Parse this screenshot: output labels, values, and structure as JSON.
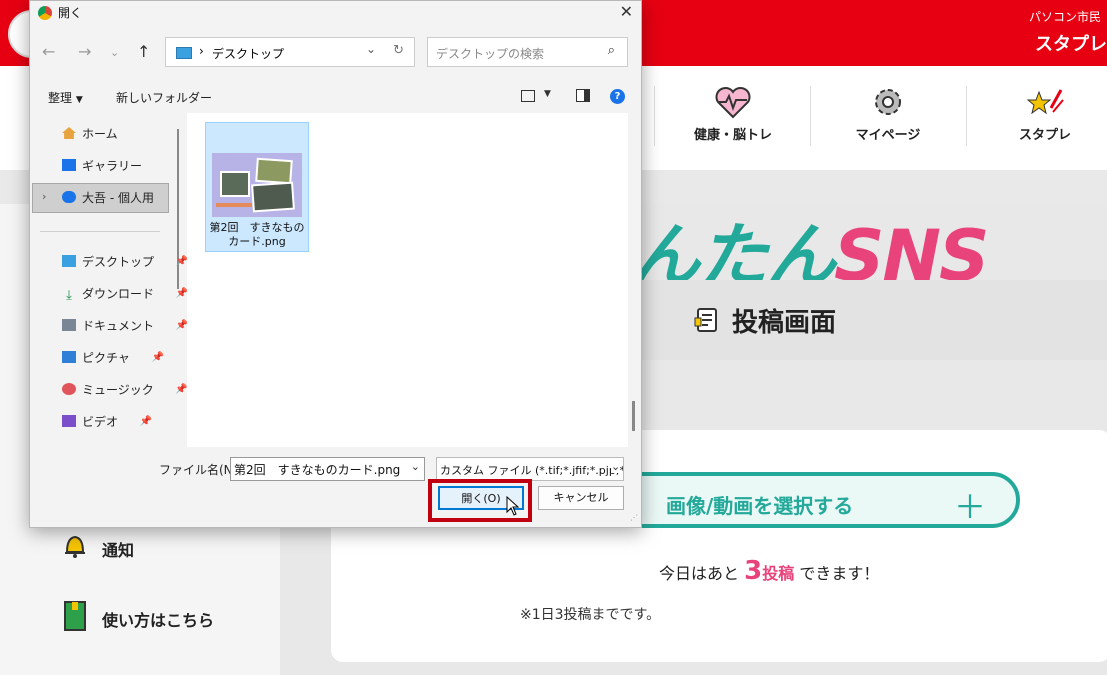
{
  "site": {
    "name": "パソコン市民",
    "brand": "スタプレ",
    "nav": [
      {
        "label": "健康・脳トレ",
        "icon": "heart-pulse-icon"
      },
      {
        "label": "マイページ",
        "icon": "gear-icon"
      },
      {
        "label": "スタプレ",
        "icon": "star-icon"
      }
    ],
    "sns_title_a": "んたん",
    "sns_title_b": "SNS",
    "post_title": "投稿画面",
    "select_media_label": "画像/動画を選択する",
    "select_media_plus": "＋",
    "remaining_prefix": "今日はあと",
    "remaining_count": "3",
    "remaining_unit": "投稿",
    "remaining_suffix": "できます！",
    "limit_note": "※1日3投稿までです。",
    "side_links": [
      {
        "label": "通知",
        "icon": "bell-icon"
      },
      {
        "label": "使い方はこちら",
        "icon": "book-icon"
      }
    ],
    "accent_red": "#e60012",
    "accent_teal": "#23a99a",
    "accent_pink": "#e8437a"
  },
  "dialog": {
    "title": "開く",
    "breadcrumb_sep": "›",
    "address": "デスクトップ",
    "search_placeholder": "デスクトップの検索",
    "organize": "整理",
    "new_folder": "新しいフォルダー",
    "nav_items": [
      {
        "label": "ホーム",
        "icon": "home-icon"
      },
      {
        "label": "ギャラリー",
        "icon": "gallery-icon"
      },
      {
        "label": "大吾 - 個人用",
        "icon": "onedrive-icon"
      },
      {
        "label": "デスクトップ",
        "icon": "desktop-icon"
      },
      {
        "label": "ダウンロード",
        "icon": "download-icon"
      },
      {
        "label": "ドキュメント",
        "icon": "document-icon"
      },
      {
        "label": "ピクチャ",
        "icon": "pictures-icon"
      },
      {
        "label": "ミュージック",
        "icon": "music-icon"
      },
      {
        "label": "ビデオ",
        "icon": "video-icon"
      }
    ],
    "file": {
      "name_line1": "第2回　すきなもの",
      "name_line2": "カード.png"
    },
    "filename_label": "ファイル名(N):",
    "filename_value": "第2回　すきなものカード.png",
    "filter_value": "カスタム ファイル (*.tif;*.jfif;*.pjp;*.i",
    "open_button": "開く(O)",
    "cancel_button": "キャンセル"
  }
}
